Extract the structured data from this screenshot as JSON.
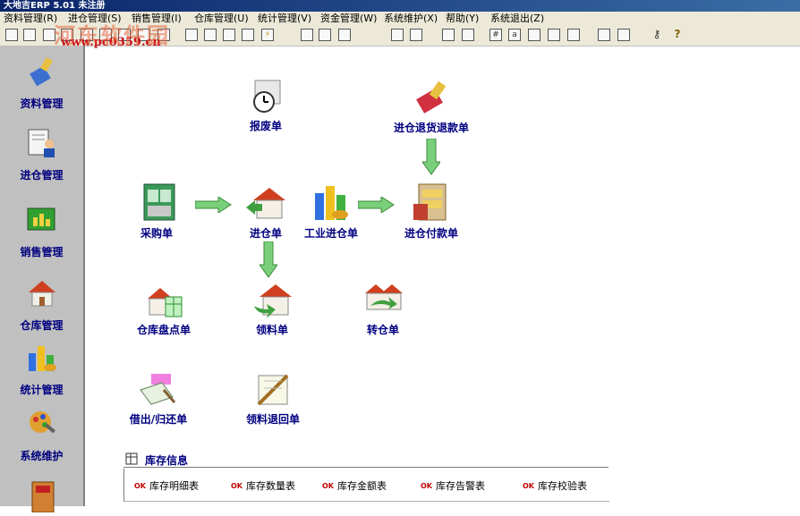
{
  "window": {
    "title": "大地吉ERP 5.01 未注册"
  },
  "menu": {
    "items": [
      "资料管理(R)",
      "进仓管理(S)",
      "销售管理(I)",
      "仓库管理(U)",
      "统计管理(V)",
      "资金管理(W)",
      "系统维护(X)",
      "帮助(Y)",
      "系统退出(Z)"
    ]
  },
  "watermark": {
    "url": "www.pc0359.cn",
    "site": "河东软件园"
  },
  "sidebar": {
    "items": [
      {
        "label": "资料管理",
        "icon": "brush-icon"
      },
      {
        "label": "进仓管理",
        "icon": "person-doc-icon"
      },
      {
        "label": "销售管理",
        "icon": "chart-window-icon"
      },
      {
        "label": "仓库管理",
        "icon": "house-icon"
      },
      {
        "label": "统计管理",
        "icon": "bar-chart-icon"
      },
      {
        "label": "系统维护",
        "icon": "tools-icon"
      },
      {
        "label": "",
        "icon": "exit-icon"
      }
    ]
  },
  "flow": {
    "baofei": "报废单",
    "jinCangTui": "进仓退货退款单",
    "caigou": "采购单",
    "jincang": "进仓单",
    "gongye": "工业进仓单",
    "fukuan": "进仓付款单",
    "pandian": "仓库盘点单",
    "lingliao": "领料单",
    "zhuancang": "转仓单",
    "jiechu": "借出/归还单",
    "tuihui": "领料退回单"
  },
  "inventory": {
    "title": "库存信息",
    "links": [
      "库存明细表",
      "库存数量表",
      "库存金额表",
      "库存告警表",
      "库存校验表"
    ],
    "badge": "OK"
  }
}
